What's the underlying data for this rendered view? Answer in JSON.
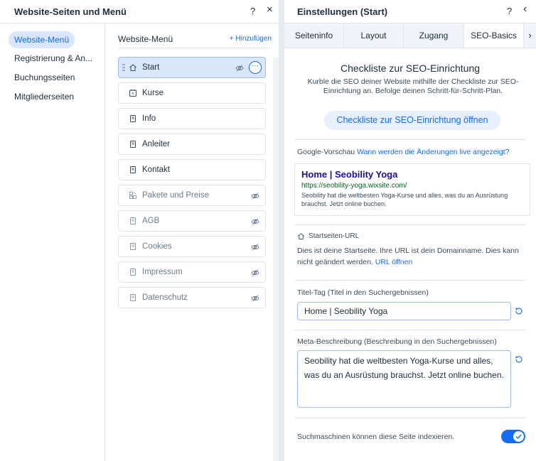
{
  "left_panel": {
    "title": "Website-Seiten und Menü",
    "help_label": "?",
    "close_label": "×",
    "nav": [
      {
        "label": "Website-Menü"
      },
      {
        "label": "Registrierung & An..."
      },
      {
        "label": "Buchungsseiten"
      },
      {
        "label": "Mitgliederseiten"
      }
    ],
    "pages_header": "Website-Menü",
    "add_label": "+ Hinzufügen",
    "pages": [
      {
        "label": "Start",
        "icon": "home-icon",
        "hidden": false,
        "selected": true
      },
      {
        "label": "Kurse",
        "icon": "calendar-icon",
        "hidden": false
      },
      {
        "label": "Info",
        "icon": "page-icon",
        "hidden": false
      },
      {
        "label": "Anleiter",
        "icon": "page-icon",
        "hidden": false
      },
      {
        "label": "Kontakt",
        "icon": "page-icon",
        "hidden": false
      },
      {
        "label": "Pakete und Preise",
        "icon": "plans-icon",
        "hidden": true
      },
      {
        "label": "AGB",
        "icon": "page-icon",
        "hidden": true
      },
      {
        "label": "Cookies",
        "icon": "page-icon",
        "hidden": true
      },
      {
        "label": "Impressum",
        "icon": "page-icon",
        "hidden": true
      },
      {
        "label": "Datenschutz",
        "icon": "page-icon",
        "hidden": true
      }
    ],
    "more_label": "···"
  },
  "right_panel": {
    "title": "Einstellungen (Start)",
    "help_label": "?",
    "back_label": "‹",
    "tabs": [
      {
        "label": "Seiteninfo"
      },
      {
        "label": "Layout"
      },
      {
        "label": "Zugang"
      },
      {
        "label": "SEO-Basics"
      }
    ],
    "tabs_more": "›",
    "seo_checklist": {
      "title": "Checkliste zur SEO-Einrichtung",
      "description": "Kurble die SEO deiner Website mithilfe der Checkliste zur SEO-Einrichtung an. Befolge deinen Schritt-für-Schritt-Plan.",
      "button_label": "Checkliste zur SEO-Einrichtung öffnen"
    },
    "google_preview": {
      "label": "Google-Vorschau",
      "link": "Wann werden die Änderungen live angezeigt?",
      "title": "Home | Seobility Yoga",
      "url": "https://seobility-yoga.wixsite.com/",
      "snippet": "Seobility hat die weltbesten Yoga-Kurse und alles, was du an Ausrüstung brauchst. Jetzt online buchen."
    },
    "start_url": {
      "label": "Startseiten-URL",
      "description": "Dies ist deine Startseite. Ihre URL ist dein Domainname. Dies kann nicht geändert werden.",
      "link": "URL öffnen"
    },
    "title_tag": {
      "label": "Titel-Tag (Titel in den Suchergebnissen)",
      "value": "Home | Seobility Yoga"
    },
    "meta_description": {
      "label": "Meta-Beschreibung (Beschreibung in den Suchergebnissen)",
      "value": "Seobility hat die weltbesten Yoga-Kurse und alles, was du an Ausrüstung brauchst. Jetzt online buchen."
    },
    "indexing": {
      "label": "Suchmaschinen können diese Seite indexieren.",
      "enabled": true
    }
  },
  "colors": {
    "accent": "#116dff",
    "selected_bg": "#d9e6fb",
    "border": "#dfe5eb",
    "text": "#20303c"
  }
}
